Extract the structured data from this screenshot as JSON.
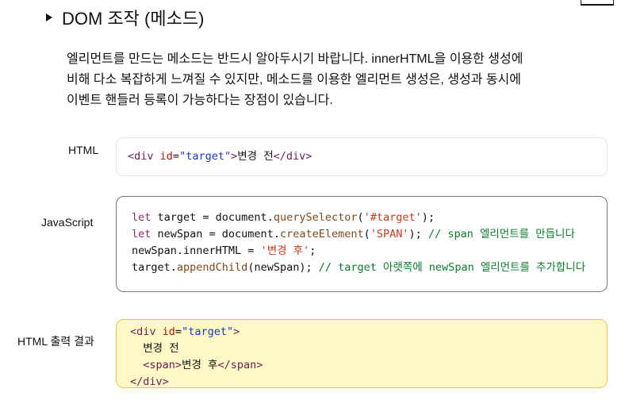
{
  "section": {
    "title": "DOM 조작 (메소드)"
  },
  "description": {
    "lines": [
      "엘리먼트를 만드는 메소드는 반드시 알아두시기 바랍니다. innerHTML을 이용한 생성에",
      "비해 다소 복잡하게 느껴질 수 있지만, 메소드를 이용한 엘리먼트 생성은, 생성과 동시에",
      "이벤트 핸들러 등록이 가능하다는 장점이 있습니다."
    ]
  },
  "html_example": {
    "label": "HTML",
    "code": {
      "open": "<div",
      "attr": "id",
      "eq": "=",
      "val": "\"target\"",
      "gt": ">",
      "text": "변경 전",
      "close": "</div>"
    }
  },
  "js_example": {
    "label": "JavaScript",
    "lines": [
      {
        "kw": "let",
        "a": " target = document.",
        "m": "querySelector",
        "b": "(",
        "s": "'#target'",
        "c": ");",
        "cm": ""
      },
      {
        "kw": "let",
        "a": " newSpan = document.",
        "m": "createElement",
        "b": "(",
        "s": "'SPAN'",
        "c": "); ",
        "cm": "// span 엘리먼트를 만듭니다"
      },
      {
        "kw": "",
        "a": "newSpan.innerHTML = ",
        "m": "",
        "b": "",
        "s": "'변경 후'",
        "c": ";",
        "cm": ""
      },
      {
        "kw": "",
        "a": "target.",
        "m": "appendChild",
        "b": "(newSpan); ",
        "s": "",
        "c": "",
        "cm": "// target 아랫쪽에 newSpan 엘리먼트를 추가합니다"
      }
    ]
  },
  "output_example": {
    "label": "HTML 출력 결과",
    "line1": {
      "open": "<div",
      "attr": "id",
      "eq": "=",
      "val": "\"target\"",
      "gt": ">"
    },
    "line2": "  변경 전",
    "line3": {
      "indent": "  ",
      "open": "<span>",
      "text": "변경 후",
      "close": "</span>"
    },
    "line4": "</div>"
  }
}
